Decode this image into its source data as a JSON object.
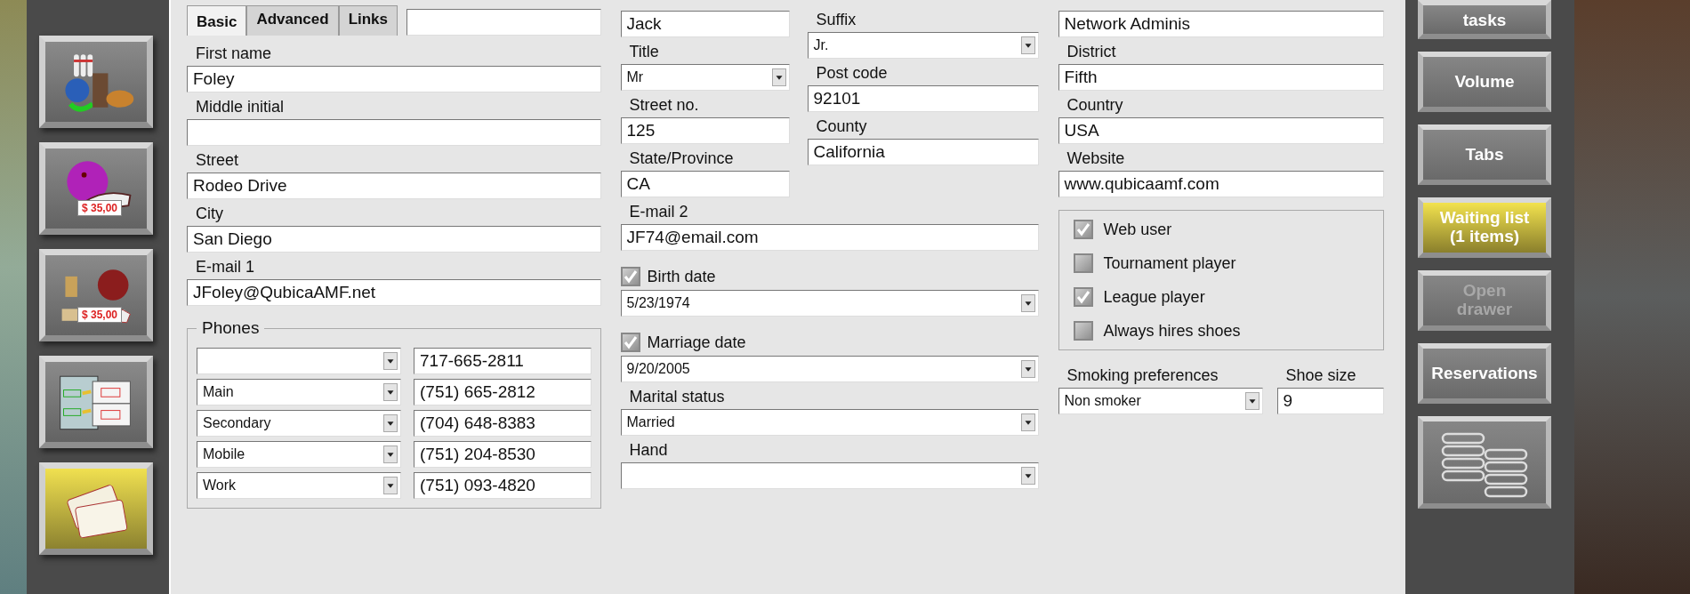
{
  "left_buttons": [
    {
      "kind": "pins-food",
      "highlighted": false
    },
    {
      "kind": "ball-shoes",
      "price_tag": "$ 35,00",
      "highlighted": false
    },
    {
      "kind": "food-ball",
      "price_tag": "$ 35,00",
      "highlighted": false
    },
    {
      "kind": "tickets",
      "highlighted": false
    },
    {
      "kind": "card",
      "highlighted": true
    }
  ],
  "tabs": [
    {
      "label": "Basic",
      "selected": true
    },
    {
      "label": "Advanced",
      "selected": false
    },
    {
      "label": "Links",
      "selected": false
    }
  ],
  "form": {
    "left": {
      "top": [
        {
          "kind": "text"
        }
      ],
      "fields": [
        {
          "label": "First name",
          "value": "Foley",
          "kind": "text"
        },
        {
          "label": "Middle initial",
          "kind": "text"
        },
        {
          "label": "Street",
          "value": "Rodeo Drive",
          "kind": "text"
        },
        {
          "label": "City",
          "value": "San Diego",
          "kind": "text"
        },
        {
          "label": "E-mail 1",
          "value": "JFoley@QubicaAMF.net",
          "kind": "text"
        }
      ],
      "phones": {
        "title": "Phones",
        "rows": [
          {
            "number": "717-665-2811"
          },
          {
            "type": "Main",
            "number": "(751) 665-2812"
          },
          {
            "type": "Secondary",
            "number": "(704) 648-8383"
          },
          {
            "type": "Mobile",
            "number": "(751) 204-8530"
          },
          {
            "type": "Work",
            "number": "(751) 093-4820"
          }
        ]
      }
    },
    "middle": {
      "col_a": [
        {
          "value": "Jack",
          "kind": "text"
        },
        {
          "label": "Title",
          "value": "Mr",
          "kind": "dropdown"
        },
        {
          "label": "Street no.",
          "value": "125",
          "kind": "text"
        },
        {
          "label": "State/Province",
          "value": "CA",
          "kind": "text"
        }
      ],
      "col_b": [
        {
          "label": "Suffix",
          "value": "Jr.",
          "kind": "dropdown"
        },
        {
          "label": "Post code",
          "value": "92101",
          "kind": "text"
        },
        {
          "label": "County",
          "value": "California",
          "kind": "text"
        }
      ],
      "lower": [
        {
          "label": "E-mail 2",
          "value": "JF74@email.com",
          "kind": "text"
        },
        {
          "label": "Birth date",
          "value": "5/23/1974",
          "kind": "date",
          "checked": true
        },
        {
          "label": "Marriage date",
          "value": "9/20/2005",
          "kind": "date",
          "checked": true
        },
        {
          "label": "Marital status",
          "value": "Married",
          "kind": "dropdown"
        },
        {
          "label": "Hand",
          "kind": "dropdown"
        }
      ]
    },
    "right": {
      "fields": [
        {
          "value": "Network Adminis",
          "kind": "text"
        },
        {
          "label": "District",
          "value": "Fifth",
          "kind": "text"
        },
        {
          "label": "Country",
          "value": "USA",
          "kind": "text"
        },
        {
          "label": "Website",
          "value": "www.qubicaamf.com",
          "kind": "text"
        }
      ],
      "flags": [
        {
          "label": "Web user",
          "checked": true
        },
        {
          "label": "Tournament player",
          "checked": false
        },
        {
          "label": "League player",
          "checked": true
        },
        {
          "label": "Always hires shoes",
          "checked": false
        }
      ],
      "bottom": [
        {
          "label": "Smoking preferences",
          "value": "Non smoker",
          "kind": "dropdown"
        },
        {
          "label": "Shoe size",
          "value": "9",
          "kind": "text"
        }
      ]
    }
  },
  "right_buttons": [
    {
      "kind": "text",
      "label": "tasks",
      "highlighted": false,
      "disabled": false
    },
    {
      "kind": "text",
      "label": "Volume",
      "highlighted": false,
      "disabled": false
    },
    {
      "kind": "text",
      "label": "Tabs",
      "highlighted": false,
      "disabled": false
    },
    {
      "kind": "text",
      "label": "Waiting list\n(1 items)",
      "highlighted": true,
      "disabled": false
    },
    {
      "kind": "text",
      "label": "Open\ndrawer",
      "highlighted": false,
      "disabled": true
    },
    {
      "kind": "text",
      "label": "Reservations",
      "highlighted": false,
      "disabled": false
    },
    {
      "kind": "lanes",
      "highlighted": false
    }
  ]
}
